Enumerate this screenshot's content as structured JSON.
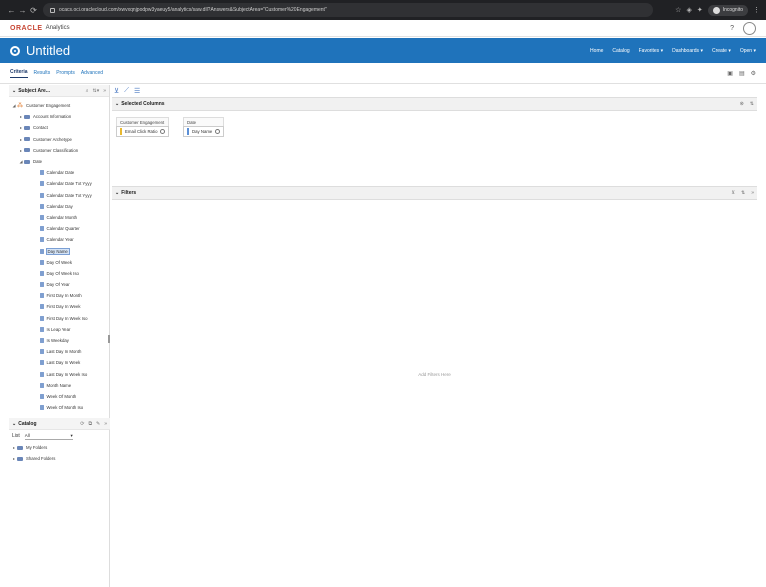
{
  "browser": {
    "url": "ocacs.oci.oraclecloud.com/xwvxqnjpodpw3yaeuy5/analytics/saw.dll?Answers&SubjectArea=\"Customer%20Engagement\"",
    "profile_label": "Incognito"
  },
  "oracle": {
    "logo": "ORACLE",
    "product": "Analytics"
  },
  "title": {
    "doc_name": "Untitled"
  },
  "topnav": [
    "Home",
    "Catalog",
    "Favorites ▾",
    "Dashboards ▾",
    "Create ▾",
    "Open ▾"
  ],
  "tabs": [
    "Criteria",
    "Results",
    "Prompts",
    "Advanced"
  ],
  "subject_areas": {
    "header": "Subject Are...",
    "root": "Customer Engagement",
    "folders": [
      "Account Information",
      "Contact",
      "Customer Archetype",
      "Customer Classification",
      "Date"
    ],
    "date_columns": [
      "Calendar Date",
      "Calendar Date Txt Yyyy",
      "Calendar Date Txt Yyyy",
      "Calendar Day",
      "Calendar Month",
      "Calendar Quarter",
      "Calendar Year",
      "Day Name",
      "Day Of Week",
      "Day Of Week Iso",
      "Day Of Year",
      "First Day In Month",
      "First Day In Week",
      "First Day In Week Iso",
      "Is Leap Year",
      "Is Weekday",
      "Last Day In Month",
      "Last Day In Week",
      "Last Day In Week Iso",
      "Month Name",
      "Week Of Month",
      "Week Of Month Iso"
    ]
  },
  "catalog": {
    "header": "Catalog",
    "list_label": "List",
    "list_value": "All",
    "folders": [
      "My Folders",
      "Shared Folders"
    ]
  },
  "selected_columns": {
    "header": "Selected Columns",
    "groups": [
      {
        "label": "Customer Engagement",
        "column": "Email Click Ratio",
        "color": "#e8b830"
      },
      {
        "label": "Date",
        "column": "Day Name",
        "color": "#5b8fd6"
      }
    ]
  },
  "filters": {
    "header": "Filters",
    "empty_text": "Add Filters Here"
  }
}
